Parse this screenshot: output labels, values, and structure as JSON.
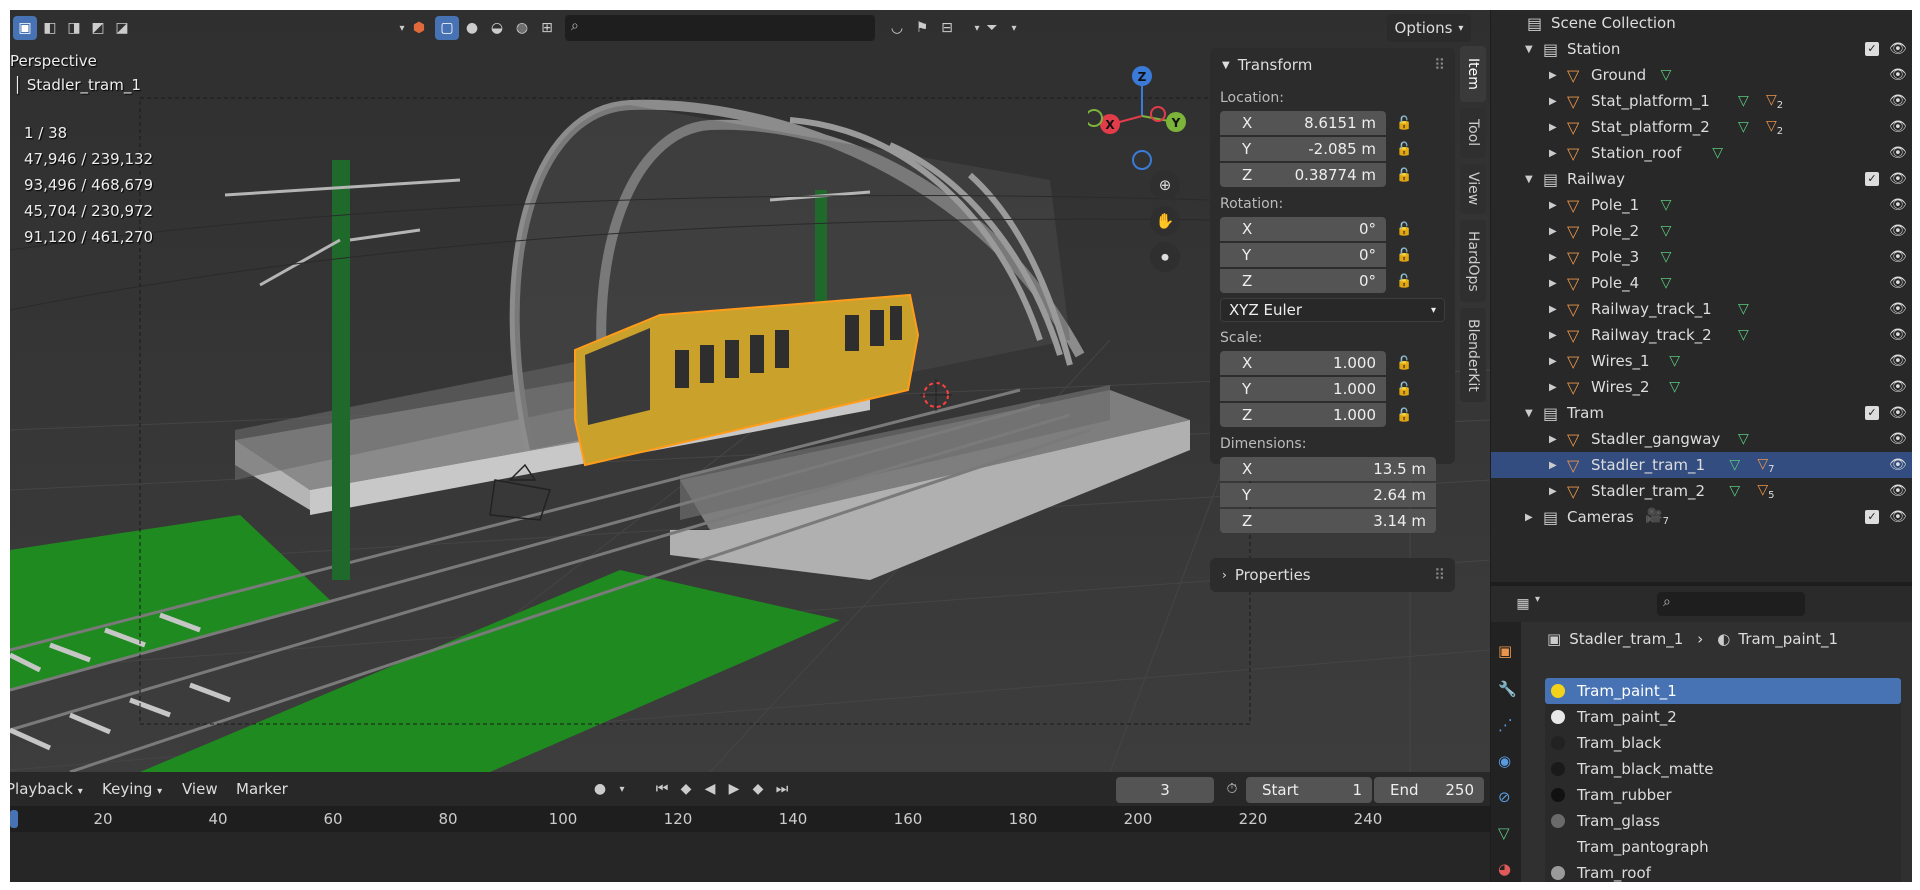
{
  "viewport": {
    "mode": "Perspective",
    "object_name": "Stadler_tram_1",
    "stats": [
      "1 / 38",
      "47,946 / 239,132",
      "93,496 / 468,679",
      "45,704 / 230,972",
      "91,120 / 461,270"
    ],
    "options_label": "Options",
    "gizmo": {
      "x": "X",
      "y": "Y",
      "z": "Z"
    }
  },
  "npanel": {
    "transform_title": "Transform",
    "location_label": "Location:",
    "location": [
      {
        "axis": "X",
        "value": "8.6151 m"
      },
      {
        "axis": "Y",
        "value": "-2.085 m"
      },
      {
        "axis": "Z",
        "value": "0.38774 m"
      }
    ],
    "rotation_label": "Rotation:",
    "rotation": [
      {
        "axis": "X",
        "value": "0°"
      },
      {
        "axis": "Y",
        "value": "0°"
      },
      {
        "axis": "Z",
        "value": "0°"
      }
    ],
    "rotation_mode": "XYZ Euler",
    "scale_label": "Scale:",
    "scale": [
      {
        "axis": "X",
        "value": "1.000"
      },
      {
        "axis": "Y",
        "value": "1.000"
      },
      {
        "axis": "Z",
        "value": "1.000"
      }
    ],
    "dimensions_label": "Dimensions:",
    "dimensions": [
      {
        "axis": "X",
        "value": "13.5 m"
      },
      {
        "axis": "Y",
        "value": "2.64 m"
      },
      {
        "axis": "Z",
        "value": "3.14 m"
      }
    ],
    "properties_title": "Properties",
    "tabs": [
      "Item",
      "Tool",
      "View",
      "HardOps",
      "BlenderKit"
    ]
  },
  "timeline": {
    "menus": [
      "Playback",
      "Keying",
      "View",
      "Marker"
    ],
    "current_frame": "3",
    "start_label": "Start",
    "start": "1",
    "end_label": "End",
    "end": "250",
    "ruler": [
      "20",
      "40",
      "60",
      "80",
      "100",
      "120",
      "140",
      "160",
      "180",
      "200",
      "220",
      "240"
    ]
  },
  "outliner": {
    "root": "Scene Collection",
    "rows": [
      {
        "label": "Station",
        "kind": "collection",
        "depth": 1,
        "expanded": true
      },
      {
        "label": "Ground",
        "kind": "object",
        "depth": 2,
        "badges": [
          {
            "icon": "mesh",
            "count": ""
          }
        ]
      },
      {
        "label": "Stat_platform_1",
        "kind": "object",
        "depth": 2,
        "badges": [
          {
            "icon": "mesh",
            "count": ""
          },
          {
            "icon": "object",
            "count": "2"
          }
        ]
      },
      {
        "label": "Stat_platform_2",
        "kind": "object",
        "depth": 2,
        "badges": [
          {
            "icon": "mesh",
            "count": ""
          },
          {
            "icon": "object",
            "count": "2"
          }
        ]
      },
      {
        "label": "Station_roof",
        "kind": "object",
        "depth": 2,
        "badges": [
          {
            "icon": "mesh",
            "count": ""
          }
        ]
      },
      {
        "label": "Railway",
        "kind": "collection",
        "depth": 1,
        "expanded": true
      },
      {
        "label": "Pole_1",
        "kind": "object",
        "depth": 2,
        "badges": [
          {
            "icon": "mesh",
            "count": ""
          }
        ]
      },
      {
        "label": "Pole_2",
        "kind": "object",
        "depth": 2,
        "badges": [
          {
            "icon": "mesh",
            "count": ""
          }
        ]
      },
      {
        "label": "Pole_3",
        "kind": "object",
        "depth": 2,
        "badges": [
          {
            "icon": "mesh",
            "count": ""
          }
        ]
      },
      {
        "label": "Pole_4",
        "kind": "object",
        "depth": 2,
        "badges": [
          {
            "icon": "mesh",
            "count": ""
          }
        ]
      },
      {
        "label": "Railway_track_1",
        "kind": "object",
        "depth": 2,
        "badges": [
          {
            "icon": "mesh",
            "count": ""
          }
        ]
      },
      {
        "label": "Railway_track_2",
        "kind": "object",
        "depth": 2,
        "badges": [
          {
            "icon": "mesh",
            "count": ""
          }
        ]
      },
      {
        "label": "Wires_1",
        "kind": "object",
        "depth": 2,
        "badges": [
          {
            "icon": "mesh",
            "count": ""
          }
        ]
      },
      {
        "label": "Wires_2",
        "kind": "object",
        "depth": 2,
        "badges": [
          {
            "icon": "mesh",
            "count": ""
          }
        ]
      },
      {
        "label": "Tram",
        "kind": "collection",
        "depth": 1,
        "expanded": true
      },
      {
        "label": "Stadler_gangway",
        "kind": "object",
        "depth": 2,
        "badges": [
          {
            "icon": "mesh",
            "count": ""
          }
        ]
      },
      {
        "label": "Stadler_tram_1",
        "kind": "object",
        "depth": 2,
        "selected": true,
        "badges": [
          {
            "icon": "mesh",
            "count": ""
          },
          {
            "icon": "object",
            "count": "7"
          }
        ]
      },
      {
        "label": "Stadler_tram_2",
        "kind": "object",
        "depth": 2,
        "badges": [
          {
            "icon": "mesh",
            "count": ""
          },
          {
            "icon": "object",
            "count": "5"
          }
        ]
      },
      {
        "label": "Cameras",
        "kind": "collection",
        "depth": 1,
        "expanded": false,
        "badges": [
          {
            "icon": "camera",
            "count": "7"
          }
        ]
      }
    ]
  },
  "properties": {
    "breadcrumb_object": "Stadler_tram_1",
    "breadcrumb_material": "Tram_paint_1",
    "materials": [
      {
        "name": "Tram_paint_1",
        "color": "#f2d21b",
        "selected": true
      },
      {
        "name": "Tram_paint_2",
        "color": "#e8e8e8"
      },
      {
        "name": "Tram_black",
        "color": "#222222"
      },
      {
        "name": "Tram_black_matte",
        "color": "#1a1a1a"
      },
      {
        "name": "Tram_rubber",
        "color": "#111111"
      },
      {
        "name": "Tram_glass",
        "color": "#6a6a6a"
      },
      {
        "name": "Tram_pantograph",
        "color": "#2a2a2a"
      },
      {
        "name": "Tram_roof",
        "color": "#9a9a9a"
      }
    ]
  },
  "colors": {
    "accent": "#4772b3",
    "selection": "#334d80",
    "mesh_icon": "#59c77d",
    "object_icon": "#e8944a",
    "tram": "#c9a12b",
    "grass": "#1f8a1f"
  }
}
